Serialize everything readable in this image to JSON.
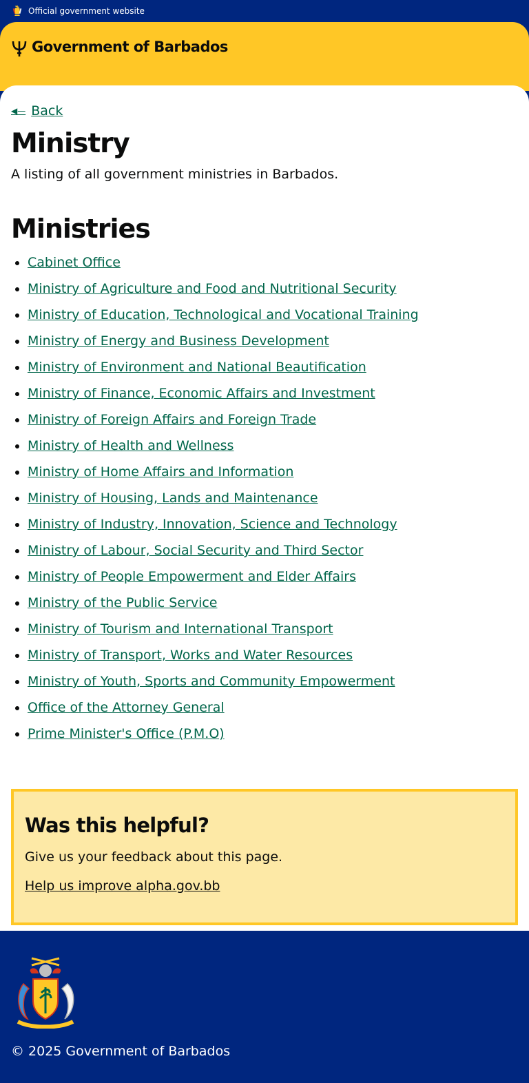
{
  "topbar": {
    "official_label": "Official government website",
    "icon": "crest-icon"
  },
  "header": {
    "site_name": "Government of Barbados",
    "icon": "trident-icon",
    "brand_color": "#ffc726"
  },
  "nav": {
    "back_label": "Back"
  },
  "page": {
    "title": "Ministry",
    "intro": "A listing of all government ministries in Barbados.",
    "section_title": "Ministries",
    "link_color": "#00654a"
  },
  "ministries": [
    "Cabinet Office",
    "Ministry of Agriculture and Food and Nutritional Security",
    "Ministry of Education, Technological and Vocational Training",
    "Ministry of Energy and Business Development",
    "Ministry of Environment and National Beautification",
    "Ministry of Finance, Economic Affairs and Investment",
    "Ministry of Foreign Affairs and Foreign Trade",
    "Ministry of Health and Wellness",
    "Ministry of Home Affairs and Information",
    "Ministry of Housing, Lands and Maintenance",
    "Ministry of Industry, Innovation, Science and Technology",
    "Ministry of Labour, Social Security and Third Sector",
    "Ministry of People Empowerment and Elder Affairs",
    "Ministry of the Public Service",
    "Ministry of Tourism and International Transport",
    "Ministry of Transport, Works and Water Resources",
    "Ministry of Youth, Sports and Community Empowerment",
    "Office of the Attorney General",
    "Prime Minister's Office (P.M.O)"
  ],
  "feedback": {
    "title": "Was this helpful?",
    "text": "Give us your feedback about this page.",
    "link": "Help us improve alpha.gov.bb"
  },
  "footer": {
    "copyright": "© 2025 Government of Barbados",
    "icon": "coat-of-arms-icon",
    "background": "#00267f"
  }
}
